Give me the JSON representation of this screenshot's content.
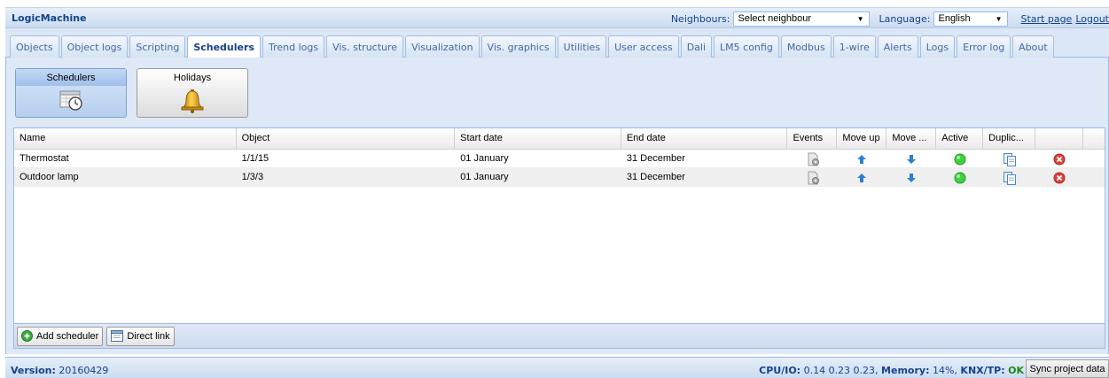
{
  "app": {
    "title": "LogicMachine",
    "neighbours_label": "Neighbours:",
    "neighbour_select": "Select neighbour",
    "language_label": "Language:",
    "language_select": "English",
    "start_page": "Start page",
    "logout": "Logout"
  },
  "tabs": [
    {
      "label": "Objects"
    },
    {
      "label": "Object logs"
    },
    {
      "label": "Scripting"
    },
    {
      "label": "Schedulers",
      "active": true
    },
    {
      "label": "Trend logs"
    },
    {
      "label": "Vis. structure"
    },
    {
      "label": "Visualization"
    },
    {
      "label": "Vis. graphics"
    },
    {
      "label": "Utilities"
    },
    {
      "label": "User access"
    },
    {
      "label": "Dali"
    },
    {
      "label": "LM5 config"
    },
    {
      "label": "Modbus"
    },
    {
      "label": "1-wire"
    },
    {
      "label": "Alerts"
    },
    {
      "label": "Logs"
    },
    {
      "label": "Error log"
    },
    {
      "label": "About"
    }
  ],
  "modes": {
    "schedulers": "Schedulers",
    "holidays": "Holidays"
  },
  "grid": {
    "columns": {
      "name": "Name",
      "object": "Object",
      "start_date": "Start date",
      "end_date": "End date",
      "events": "Events",
      "move_up": "Move up",
      "move_down": "Move ...",
      "active": "Active",
      "duplicate": "Duplic..."
    },
    "rows": [
      {
        "name": "Thermostat",
        "object": "1/1/15",
        "start_date": "01 January",
        "end_date": "31 December"
      },
      {
        "name": "Outdoor lamp",
        "object": "1/3/3",
        "start_date": "01 January",
        "end_date": "31 December"
      }
    ]
  },
  "toolbar": {
    "add_scheduler": "Add scheduler",
    "direct_link": "Direct link"
  },
  "status": {
    "version_label": "Version:",
    "version": "20160429",
    "cpu_label": "CPU/IO:",
    "cpu_value": "0.14 0.23 0.23,",
    "memory_label": "Memory:",
    "memory_value": "14%,",
    "knx_label": "KNX/TP:",
    "knx_value": "OK",
    "sync": "Sync project data"
  },
  "colors": {
    "header_blue": "#15428b",
    "panel_bg": "#dfe8f6",
    "border_blue": "#99bbe8",
    "active_green": "#22cc22",
    "delete_red": "#e53935",
    "arrow_blue": "#1e78c8"
  }
}
